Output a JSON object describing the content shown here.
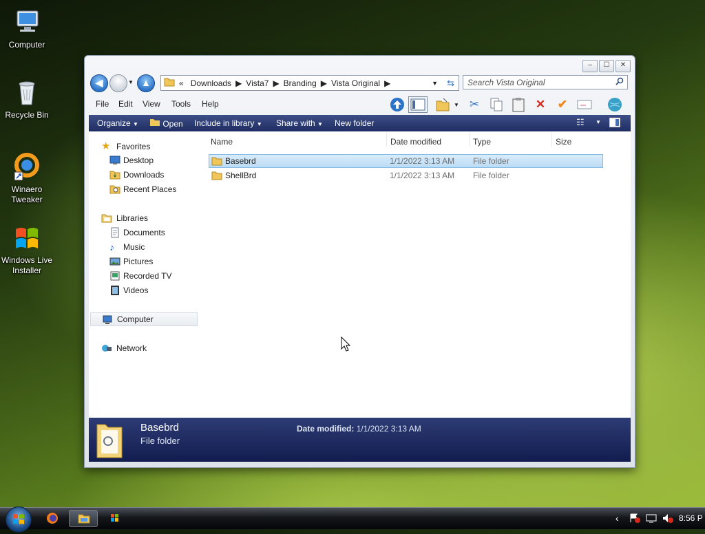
{
  "desktop": {
    "icons": [
      {
        "label": "Computer",
        "icon": "computer-icon"
      },
      {
        "label": "Recycle Bin",
        "icon": "recycle-bin-icon"
      },
      {
        "label_line1": "Winaero",
        "label_line2": "Tweaker",
        "icon": "winaero-tweaker-icon"
      },
      {
        "label_line1": "Windows Live",
        "label_line2": "Installer",
        "icon": "windows-live-installer-icon"
      }
    ]
  },
  "window": {
    "buttons": {
      "minimize": "–",
      "maximize": "☐",
      "close": "✕"
    },
    "address": {
      "overflow": "«",
      "crumbs": [
        "Downloads",
        "Vista7",
        "Branding",
        "Vista Original"
      ]
    },
    "search": {
      "placeholder": "Search Vista Original"
    },
    "menu": [
      "File",
      "Edit",
      "View",
      "Tools",
      "Help"
    ],
    "commandbar": {
      "organize": "Organize",
      "open": "Open",
      "include": "Include in library",
      "share": "Share with",
      "newfolder": "New folder"
    },
    "navigation": {
      "favorites": {
        "label": "Favorites",
        "items": [
          "Desktop",
          "Downloads",
          "Recent Places"
        ]
      },
      "libraries": {
        "label": "Libraries",
        "items": [
          "Documents",
          "Music",
          "Pictures",
          "Recorded TV",
          "Videos"
        ]
      },
      "computer": "Computer",
      "network": "Network"
    },
    "columns": [
      "Name",
      "Date modified",
      "Type",
      "Size"
    ],
    "files": [
      {
        "name": "Basebrd",
        "date": "1/1/2022 3:13 AM",
        "type": "File folder",
        "size": "",
        "selected": true
      },
      {
        "name": "ShellBrd",
        "date": "1/1/2022 3:13 AM",
        "type": "File folder",
        "size": "",
        "selected": false
      }
    ],
    "details": {
      "name": "Basebrd",
      "kind": "File folder",
      "date_label": "Date modified:",
      "date_value": "1/1/2022 3:13 AM"
    }
  },
  "taskbar": {
    "clock": "8:56 P",
    "apps": [
      "firefox-icon",
      "explorer-icon",
      "windows-live-icon"
    ]
  },
  "colors": {
    "command_bar": "#1f2d63",
    "selection": "#bcdcf5",
    "folder": "#f0c65a"
  }
}
